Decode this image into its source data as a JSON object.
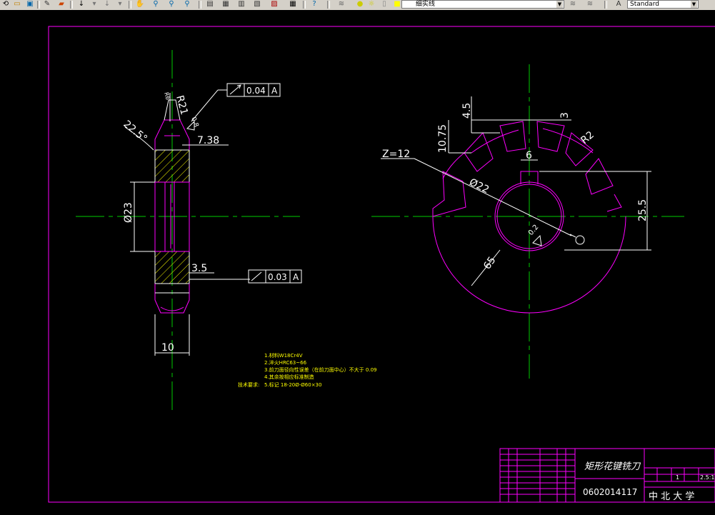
{
  "toolbar": {
    "layer_name": "细实线",
    "text_style": "Standard",
    "icons": [
      "undo-icon",
      "open-icon",
      "pencil-icon",
      "brush-icon",
      "redo-icon",
      "arrow-icon",
      "pan-icon",
      "zoom-realtime-icon",
      "zoom-window-icon",
      "zoom-previous-icon",
      "properties-icon",
      "design-center-icon",
      "tool-palette-icon",
      "sheet-set-icon",
      "markup-icon",
      "calculator-icon",
      "layer-manager-icon",
      "lightbulb-icon",
      "sun-icon",
      "color-square-icon",
      "layer-state-icon",
      "layer-previous-icon",
      "text-style-icon"
    ]
  },
  "drawing": {
    "left_view": {
      "dim_r21": "R21",
      "dim_small_top": "R6",
      "dim_225": "22.5°",
      "dim_08": "0.8",
      "dim_738": "7.38",
      "dim_d23": "Ø23",
      "dim_35": "3.5",
      "dim_10": "10",
      "gdt1_value": "0.04",
      "gdt1_datum": "A",
      "gdt2_value": "0.03",
      "gdt2_datum": "A"
    },
    "right_view": {
      "dim_45": "4.5",
      "dim_1075": "10.75",
      "dim_3": "3",
      "dim_r2": "R2",
      "dim_z12": "Z=12",
      "dim_6": "6",
      "dim_d22": "Ø22",
      "dim_255": "25.5",
      "dim_02": "0.2",
      "dim_65": "65"
    },
    "notes": {
      "label": "技术要求:",
      "lines": [
        "1.材料W18Cr4V",
        "2.淬火HRC63~66",
        "3.前刀面径向性误差（在前刀面中心）不大于 0.09",
        "4.其余按相应标准制造",
        "5.标记 18-20Ø-Ø60×30"
      ]
    },
    "title_block": {
      "part_name": "矩形花键铣刀",
      "drawing_no": "0602014117",
      "school": "中 北 大 学",
      "scale": "2.5:1",
      "count": "1"
    }
  }
}
